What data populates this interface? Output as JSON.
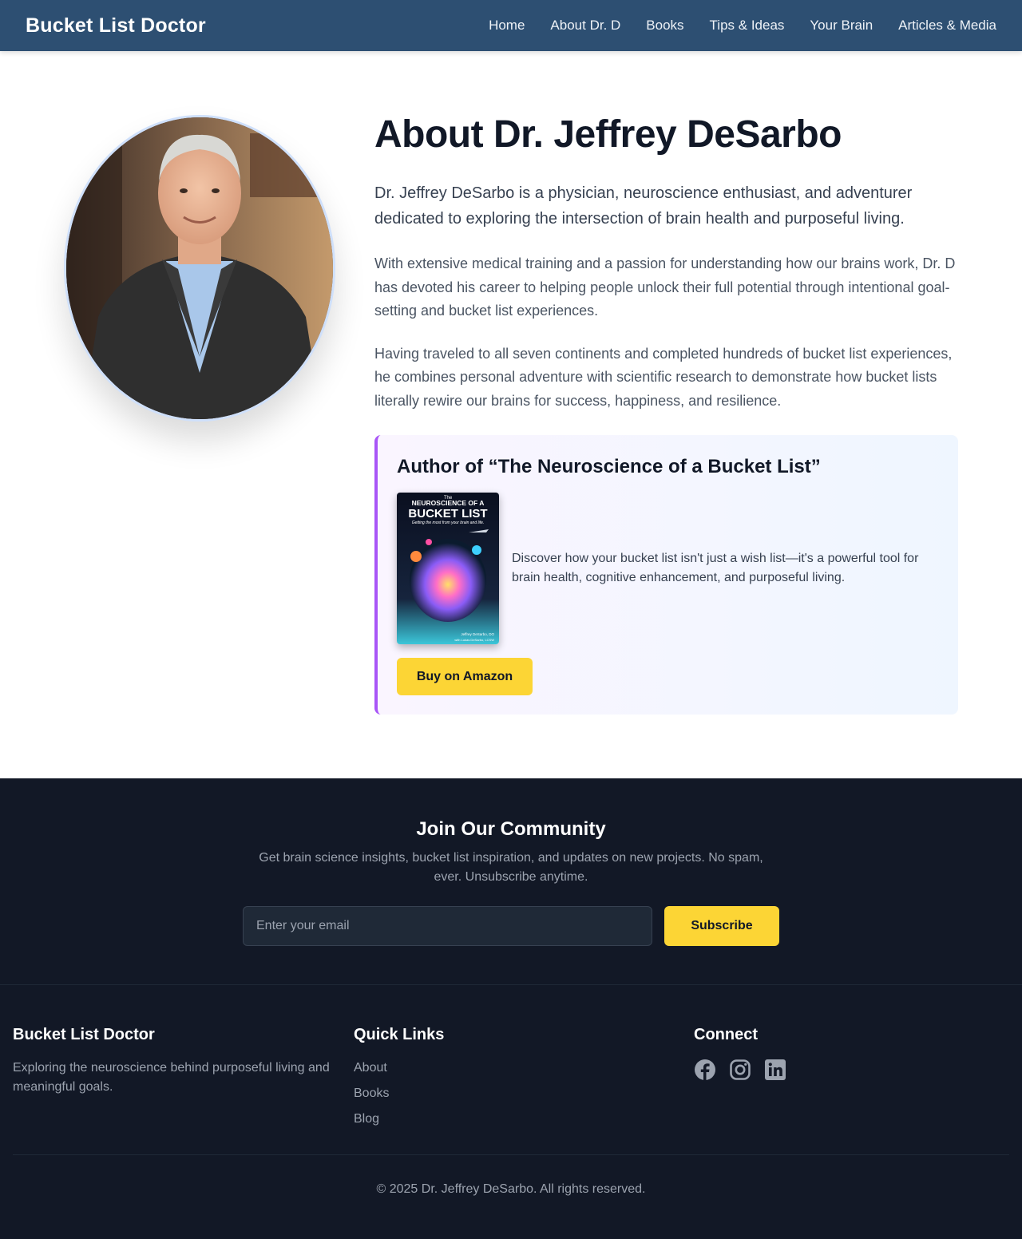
{
  "nav": {
    "brand": "Bucket List Doctor",
    "links": [
      "Home",
      "About Dr. D",
      "Books",
      "Tips & Ideas",
      "Your Brain",
      "Articles & Media"
    ]
  },
  "about": {
    "title": "About Dr. Jeffrey DeSarbo",
    "lead": "Dr. Jeffrey DeSarbo is a physician, neuroscience enthusiast, and adventurer dedicated to exploring the intersection of brain health and purposeful living.",
    "para1": "With extensive medical training and a passion for understanding how our brains work, Dr. D has devoted his career to helping people unlock their full potential through intentional goal-setting and bucket list experiences.",
    "para2": "Having traveled to all seven continents and completed hundreds of bucket list experiences, he combines personal adventure with scientific research to demonstrate how bucket lists literally rewire our brains for success, happiness, and resilience."
  },
  "book": {
    "heading": "Author of “The Neuroscience of a Bucket List”",
    "cover_line1": "The",
    "cover_line2": "NEUROSCIENCE OF A",
    "cover_line3": "BUCKET LIST",
    "cover_tagline": "Getting the most from your brain and life.",
    "cover_author": "Jeffrey DeSarbo, DO",
    "cover_coauthor": "with Lukas DeSarbo, LCSW",
    "description": "Discover how your bucket list isn't just a wish list—it's a powerful tool for brain health, cognitive enhancement, and purposeful living.",
    "buy_label": "Buy on Amazon"
  },
  "newsletter": {
    "title": "Join Our Community",
    "subtitle": "Get brain science insights, bucket list inspiration, and updates on new projects. No spam, ever. Unsubscribe anytime.",
    "placeholder": "Enter your email",
    "button": "Subscribe"
  },
  "footer": {
    "brand_title": "Bucket List Doctor",
    "brand_text": "Exploring the neuroscience behind purposeful living and meaningful goals.",
    "quick_title": "Quick Links",
    "quick_links": [
      "About",
      "Books",
      "Blog"
    ],
    "connect_title": "Connect",
    "social_icons": [
      "facebook-icon",
      "instagram-icon",
      "linkedin-icon"
    ],
    "copyright": "© 2025 Dr. Jeffrey DeSarbo. All rights reserved."
  },
  "colors": {
    "nav_bg": "#2d4f72",
    "accent_yellow": "#fcd535",
    "accent_purple": "#a855f7",
    "footer_bg": "#121826"
  }
}
